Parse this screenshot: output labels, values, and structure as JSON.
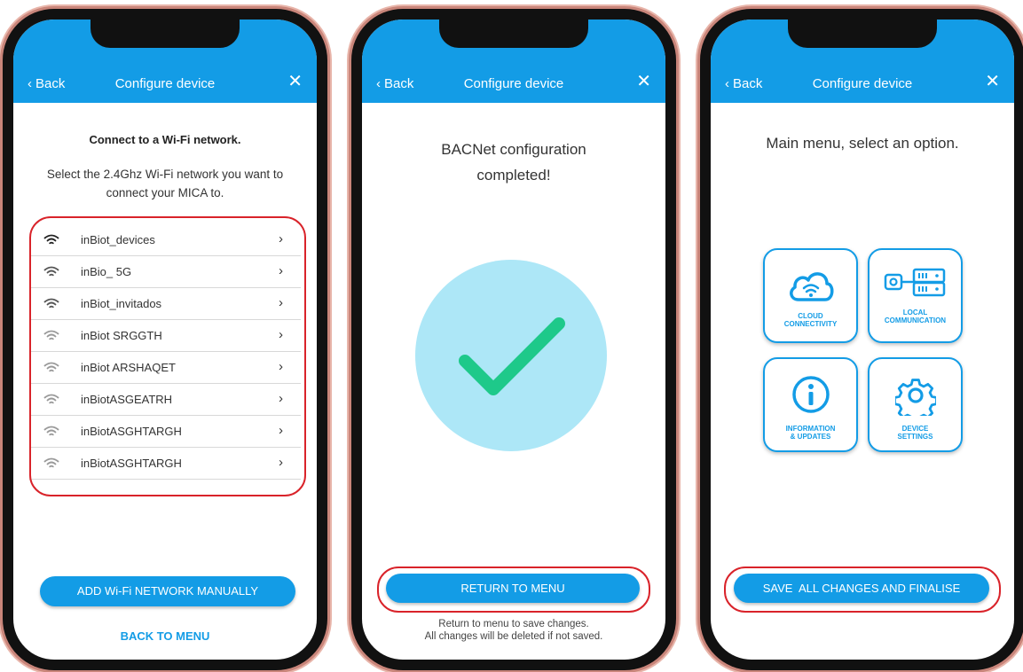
{
  "header": {
    "back_label": "Back",
    "title": "Configure device",
    "close_icon": "close-icon"
  },
  "screen1": {
    "heading": "Connect to a Wi-Fi network.",
    "subtitle": "Select the 2.4Ghz Wi-Fi network you want to connect your MICA to.",
    "networks": [
      {
        "name": "inBiot_devices",
        "signal": 4
      },
      {
        "name": "inBio_ 5G",
        "signal": 3
      },
      {
        "name": "inBiot_invitados",
        "signal": 3
      },
      {
        "name": "inBiot SRGGTH",
        "signal": 2
      },
      {
        "name": "inBiot ARSHAQET",
        "signal": 2
      },
      {
        "name": "inBiotASGEATRH",
        "signal": 2
      },
      {
        "name": "inBiotASGHTARGH",
        "signal": 2
      },
      {
        "name": "inBiotASGHTARGH",
        "signal": 2
      }
    ],
    "add_button": "ADD Wi-Fi NETWORK MANUALLY",
    "back_to_menu": "BACK TO MENU"
  },
  "screen2": {
    "title_line1": "BACNet configuration",
    "title_line2": "completed!",
    "return_button": "RETURN TO MENU",
    "note_line1": "Return to menu to save changes.",
    "note_line2": "All changes will be deleted if not saved.",
    "check_icon": "checkmark-icon"
  },
  "screen3": {
    "title": "Main menu, select an option.",
    "tiles": [
      {
        "line1": "CLOUD",
        "line2": "CONNECTIVITY",
        "icon": "cloud-wifi-icon"
      },
      {
        "line1": "LOCAL",
        "line2": "COMMUNICATION",
        "icon": "server-icon"
      },
      {
        "line1": "INFORMATION",
        "line2": "& UPDATES",
        "icon": "info-icon"
      },
      {
        "line1": "DEVICE",
        "line2": "SETTINGS",
        "icon": "gear-icon"
      }
    ],
    "save_button": "SAVE  ALL CHANGES AND FINALISE"
  },
  "colors": {
    "accent": "#139ce6",
    "highlight_outline": "#d9232a",
    "check_bg": "#ade7f7",
    "check_mark": "#1ec98a"
  }
}
